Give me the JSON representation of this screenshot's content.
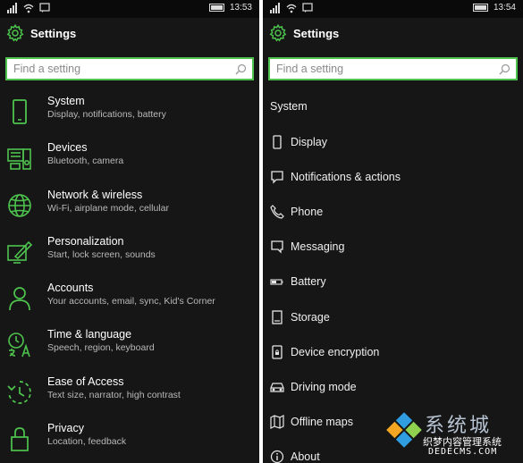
{
  "accent_color": "#4ec44e",
  "left": {
    "status": {
      "time": "13:53"
    },
    "header": {
      "title": "Settings"
    },
    "search": {
      "placeholder": "Find a setting"
    },
    "categories": [
      {
        "title": "System",
        "subtitle": "Display, notifications, battery",
        "icon": "phone-icon"
      },
      {
        "title": "Devices",
        "subtitle": "Bluetooth, camera",
        "icon": "devices-icon"
      },
      {
        "title": "Network & wireless",
        "subtitle": "Wi-Fi, airplane mode, cellular",
        "icon": "globe-icon"
      },
      {
        "title": "Personalization",
        "subtitle": "Start, lock screen, sounds",
        "icon": "paint-icon"
      },
      {
        "title": "Accounts",
        "subtitle": "Your accounts, email, sync, Kid's Corner",
        "icon": "person-icon"
      },
      {
        "title": "Time & language",
        "subtitle": "Speech, region, keyboard",
        "icon": "time-language-icon"
      },
      {
        "title": "Ease of Access",
        "subtitle": "Text size, narrator, high contrast",
        "icon": "ease-of-access-icon"
      },
      {
        "title": "Privacy",
        "subtitle": "Location, feedback",
        "icon": "lock-icon"
      }
    ]
  },
  "right": {
    "status": {
      "time": "13:54"
    },
    "header": {
      "title": "Settings"
    },
    "search": {
      "placeholder": "Find a setting"
    },
    "section_label": "System",
    "items": [
      {
        "label": "Display",
        "icon": "display-icon"
      },
      {
        "label": "Notifications & actions",
        "icon": "notification-icon"
      },
      {
        "label": "Phone",
        "icon": "handset-icon"
      },
      {
        "label": "Messaging",
        "icon": "message-icon"
      },
      {
        "label": "Battery",
        "icon": "battery-icon"
      },
      {
        "label": "Storage",
        "icon": "storage-icon"
      },
      {
        "label": "Device encryption",
        "icon": "encryption-icon"
      },
      {
        "label": "Driving mode",
        "icon": "car-icon"
      },
      {
        "label": "Offline maps",
        "icon": "map-icon"
      },
      {
        "label": "About",
        "icon": "info-icon"
      }
    ]
  },
  "watermark": {
    "big": "系统城",
    "line2": "织梦内容管理系统",
    "line3": "DEDECMS.COM"
  }
}
